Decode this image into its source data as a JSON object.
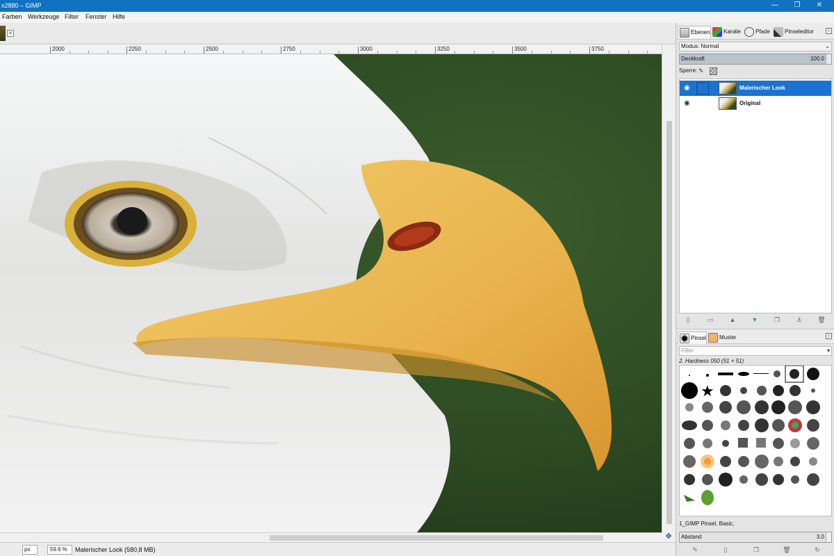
{
  "window": {
    "title": "x2880 – GIMP"
  },
  "window_controls": {
    "minimize": "—",
    "maximize": "❐",
    "close": "✕"
  },
  "menubar": {
    "items": [
      "Farben",
      "Werkzeuge",
      "Filter",
      "Fenster",
      "Hilfe"
    ]
  },
  "image_tab": {
    "close_label": "×"
  },
  "ruler": {
    "labels": [
      "2000",
      "2250",
      "2500",
      "2750",
      "3000",
      "3250",
      "3500",
      "3750"
    ]
  },
  "statusbar": {
    "unit": "px",
    "zoom": "59.6 %",
    "info": "Malerischer Look (580,8 MB)"
  },
  "dock": {
    "tabs": [
      {
        "label": "Ebenen",
        "icon": "layers-icon"
      },
      {
        "label": "Kanäle",
        "icon": "channels-icon"
      },
      {
        "label": "Pfade",
        "icon": "paths-icon"
      },
      {
        "label": "Pinseleditor",
        "icon": "brush-editor-icon"
      }
    ],
    "mode": "Modus: Normal",
    "opacity_label": "Deckkraft",
    "opacity_value": "100.0",
    "lock_label": "Sperre:",
    "layers": [
      {
        "name": "Malerischer Look",
        "selected": true
      },
      {
        "name": "Original",
        "selected": false
      }
    ],
    "brush_tabs": [
      {
        "label": "Pinsel",
        "icon": "brush-icon"
      },
      {
        "label": "Muster",
        "icon": "pattern-icon"
      }
    ],
    "filter_placeholder": "Filter",
    "active_brush": "2. Hardness 050 (51 × 51)",
    "brush_description": "1_GIMP Pinsel, Basic,",
    "spacing_label": "Abstand",
    "spacing_value": "3.0"
  },
  "colors": {
    "titlebar": "#1272c2",
    "selection": "#1a73d1",
    "background_green": "#2c4a20",
    "beak_yellow": "#e8b14a"
  }
}
